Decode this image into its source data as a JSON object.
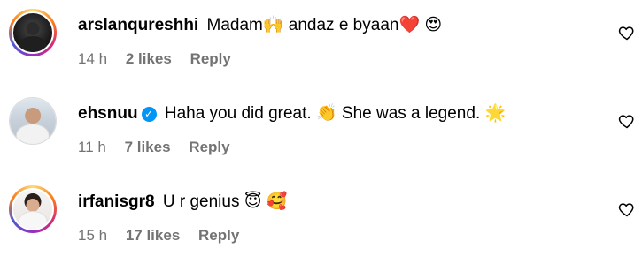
{
  "comments": [
    {
      "username": "arslanqureshhi",
      "verified": false,
      "text": "Madam🙌 andaz e byaan❤️ 😍",
      "time": "14 h",
      "likes": "2 likes",
      "reply": "Reply",
      "avatar_icon": "avatar-with-story-ring"
    },
    {
      "username": "ehsnuu",
      "verified": true,
      "verified_icon": "verified-badge-icon",
      "text": "Haha you did great. 👏 She was a legend. 🌟",
      "time": "11 h",
      "likes": "7 likes",
      "reply": "Reply",
      "avatar_icon": "avatar"
    },
    {
      "username": "irfanisgr8",
      "verified": false,
      "text": "U r genius 😇 🥰",
      "time": "15 h",
      "likes": "17 likes",
      "reply": "Reply",
      "avatar_icon": "avatar-with-story-ring"
    }
  ],
  "icons": {
    "like": "heart-outline-icon"
  },
  "colors": {
    "meta_text": "#737373",
    "verified_blue": "#0095f6"
  }
}
